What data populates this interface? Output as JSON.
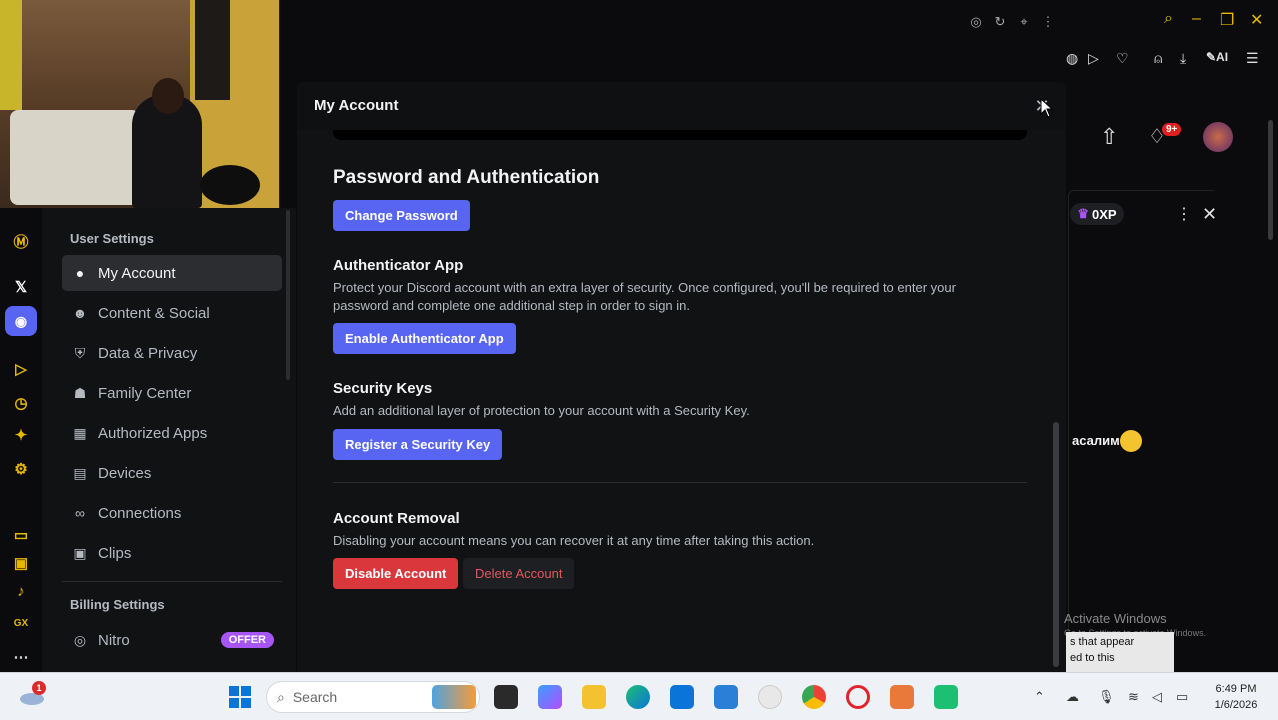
{
  "modal": {
    "title": "My Account",
    "close_icon": "close-icon",
    "password_section": {
      "heading": "Password and Authentication",
      "change_password": "Change Password"
    },
    "authenticator": {
      "heading": "Authenticator App",
      "description": "Protect your Discord account with an extra layer of security. Once configured, you'll be required to enter your password and complete one additional step in order to sign in.",
      "button": "Enable Authenticator App"
    },
    "security_keys": {
      "heading": "Security Keys",
      "description": "Add an additional layer of protection to your account with a Security Key.",
      "button": "Register a Security Key"
    },
    "removal": {
      "heading": "Account Removal",
      "description": "Disabling your account means you can recover it at any time after taking this action.",
      "disable": "Disable Account",
      "delete": "Delete Account"
    }
  },
  "sidebar": {
    "user_settings_header": "User Settings",
    "items": [
      {
        "label": "My Account",
        "icon": "person-icon",
        "active": true
      },
      {
        "label": "Content & Social",
        "icon": "smile-icon"
      },
      {
        "label": "Data & Privacy",
        "icon": "shield-icon"
      },
      {
        "label": "Family Center",
        "icon": "family-icon"
      },
      {
        "label": "Authorized Apps",
        "icon": "apps-icon"
      },
      {
        "label": "Devices",
        "icon": "devices-icon"
      },
      {
        "label": "Connections",
        "icon": "link-icon"
      },
      {
        "label": "Clips",
        "icon": "clips-icon"
      }
    ],
    "billing_header": "Billing Settings",
    "nitro": {
      "label": "Nitro",
      "badge": "OFFER"
    }
  },
  "right_panel": {
    "xp": "0XP",
    "notif_badge": "9+",
    "chat_text": "асалим",
    "toast_line1": "s that appear",
    "toast_line2": "ed to this",
    "activate_title": "Activate Windows",
    "activate_sub": "Go to Settings to activate Windows."
  },
  "taskbar": {
    "search_placeholder": "Search",
    "time": "6:49 PM",
    "date": "1/6/2026",
    "weather_badge": "1"
  },
  "colors": {
    "blurple": "#5865f2",
    "danger": "#da373c",
    "accent": "#e6b800"
  }
}
